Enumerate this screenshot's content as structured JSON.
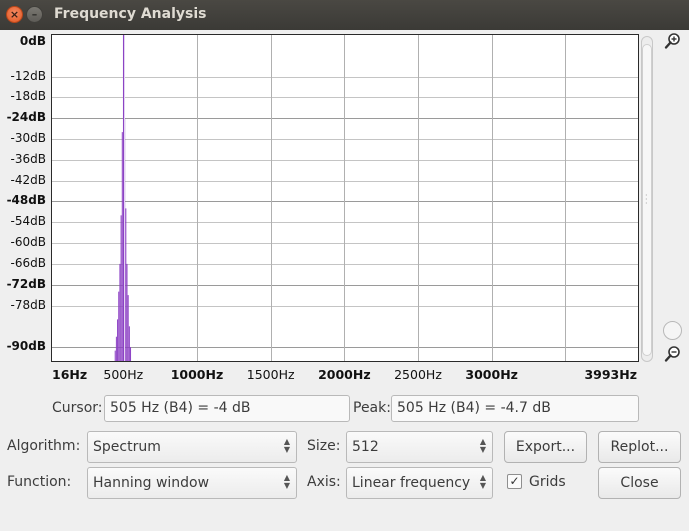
{
  "window": {
    "title": "Frequency Analysis"
  },
  "chart_data": {
    "type": "bar",
    "title": "",
    "xlabel": "",
    "ylabel": "",
    "x_unit": "Hz",
    "y_unit": "dB",
    "xlim": [
      16,
      3993
    ],
    "ylim": [
      -94,
      0
    ],
    "grid": true,
    "y_ticks": [
      {
        "label": "0dB",
        "value": 0,
        "major": true
      },
      {
        "label": "-12dB",
        "value": -12,
        "major": false
      },
      {
        "label": "-18dB",
        "value": -18,
        "major": false
      },
      {
        "label": "-24dB",
        "value": -24,
        "major": true
      },
      {
        "label": "-30dB",
        "value": -30,
        "major": false
      },
      {
        "label": "-36dB",
        "value": -36,
        "major": false
      },
      {
        "label": "-42dB",
        "value": -42,
        "major": false
      },
      {
        "label": "-48dB",
        "value": -48,
        "major": true
      },
      {
        "label": "-54dB",
        "value": -54,
        "major": false
      },
      {
        "label": "-60dB",
        "value": -60,
        "major": false
      },
      {
        "label": "-66dB",
        "value": -66,
        "major": false
      },
      {
        "label": "-72dB",
        "value": -72,
        "major": true
      },
      {
        "label": "-78dB",
        "value": -78,
        "major": false
      },
      {
        "label": "-90dB",
        "value": -90,
        "major": true
      }
    ],
    "x_ticks": [
      {
        "label": "16Hz",
        "value": 16,
        "major": true
      },
      {
        "label": "500Hz",
        "value": 500,
        "major": false
      },
      {
        "label": "1000Hz",
        "value": 1000,
        "major": true
      },
      {
        "label": "1500Hz",
        "value": 1500,
        "major": false
      },
      {
        "label": "2000Hz",
        "value": 2000,
        "major": true
      },
      {
        "label": "2500Hz",
        "value": 2500,
        "major": false
      },
      {
        "label": "3000Hz",
        "value": 3000,
        "major": true
      },
      {
        "label": "3993Hz",
        "value": 3993,
        "major": true
      }
    ],
    "x_grid": [
      500,
      1000,
      1500,
      2000,
      2500,
      3000,
      3500
    ],
    "cursor_hz": 505,
    "bar_color": "#8b3fc4",
    "series": [
      {
        "x": [
          437,
          445,
          453,
          461,
          469,
          477,
          485,
          493,
          501,
          509,
          517,
          525,
          533,
          541,
          549,
          557,
          565
        ],
        "values": [
          -94,
          -91,
          -87,
          -82,
          -74,
          -66,
          -52,
          -28,
          0,
          -24,
          -50,
          -66,
          -75,
          -84,
          -90,
          -94,
          -94
        ]
      }
    ]
  },
  "cursor": {
    "label": "Cursor:",
    "value": "505 Hz (B4) = -4 dB"
  },
  "peak": {
    "label": "Peak:",
    "value": "505 Hz (B4) = -4.7 dB"
  },
  "algorithm": {
    "label": "Algorithm:",
    "value": "Spectrum"
  },
  "size": {
    "label": "Size:",
    "value": "512"
  },
  "function": {
    "label": "Function:",
    "value": "Hanning window"
  },
  "axis": {
    "label": "Axis:",
    "value": "Linear frequency"
  },
  "grids": {
    "label": "Grids",
    "checked": true
  },
  "buttons": {
    "export": "Export...",
    "replot": "Replot...",
    "close": "Close"
  }
}
